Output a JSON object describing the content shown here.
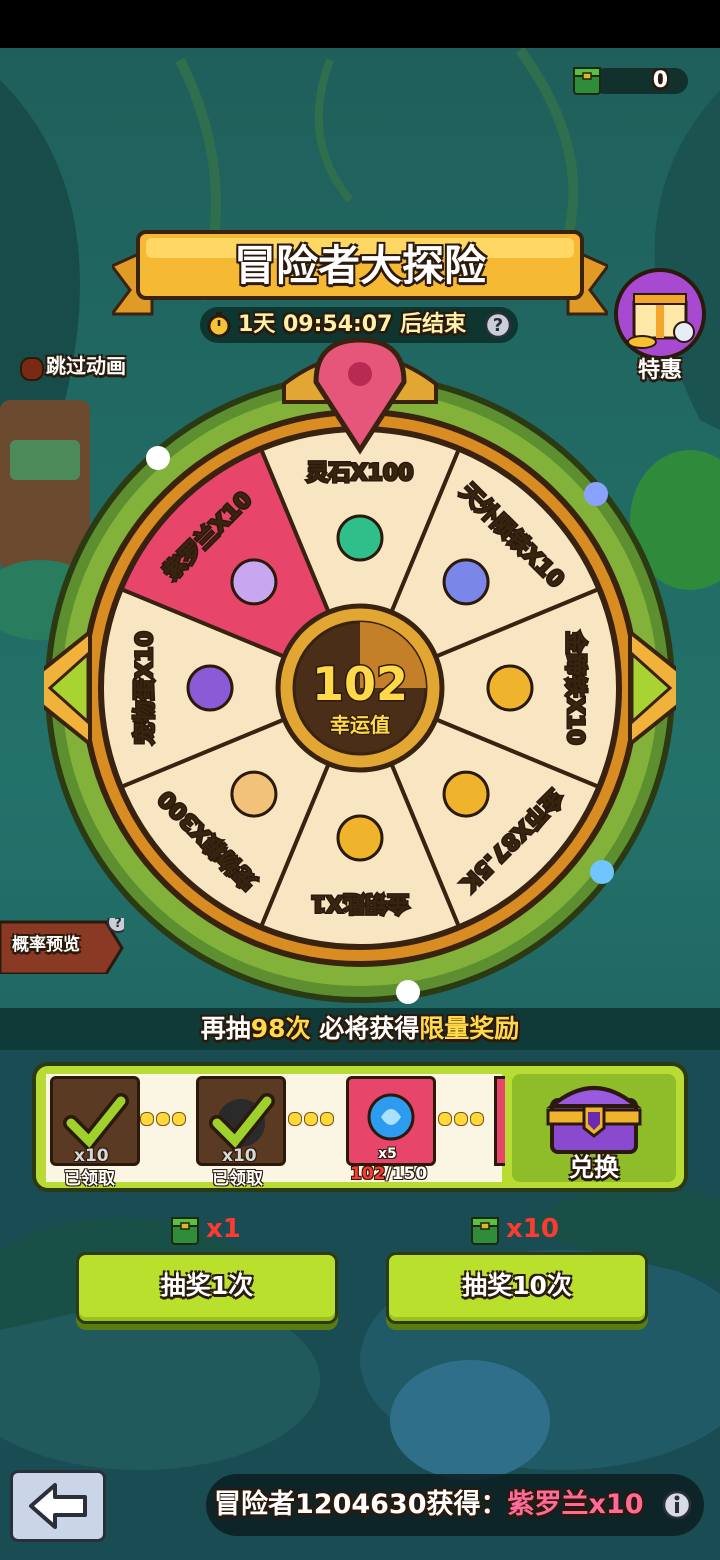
{
  "header": {
    "ticket_count": "0"
  },
  "event": {
    "title": "冒险者大探险",
    "timer": "1天 09:54:07 后结束"
  },
  "skip_animation": {
    "label": "跳过动画"
  },
  "special_offer": {
    "label": "特惠"
  },
  "wheel": {
    "segments": [
      {
        "label": "灵石X100",
        "icon": "spirit-stone-icon"
      },
      {
        "label": "天外陨铁X10",
        "icon": "meteorite-icon"
      },
      {
        "label": "金蹄铁X10",
        "icon": "horseshoe-icon"
      },
      {
        "label": "金币X87.5K",
        "icon": "gold-coin-icon"
      },
      {
        "label": "金钥匙X1",
        "icon": "golden-key-icon"
      },
      {
        "label": "宠物粮X300",
        "icon": "pet-food-bone-icon"
      },
      {
        "label": "宠物蛋X10",
        "icon": "pet-egg-icon"
      },
      {
        "label": "紫罗兰X10",
        "icon": "violet-flower-icon",
        "highlighted": true
      }
    ],
    "luck_value": "102",
    "luck_label": "幸运值"
  },
  "probability_preview": {
    "label": "概率预览"
  },
  "guarantee": {
    "prefix": "再抽",
    "count": "98次",
    "middle": " 必将获得",
    "reward": "限量奖励"
  },
  "milestones": [
    {
      "qty": "x10",
      "status": "已领取"
    },
    {
      "qty": "x10",
      "status": "已领取"
    },
    {
      "qty": "x5",
      "progress_current": "102",
      "progress_total": "/150"
    }
  ],
  "exchange": {
    "label": "兑换"
  },
  "draw_once": {
    "cost": "x1",
    "label": "抽奖1次"
  },
  "draw_ten": {
    "cost": "x10",
    "label": "抽奖10次"
  },
  "ticker": {
    "player": "冒险者1204630获得：",
    "item": "紫罗兰x10"
  },
  "colors": {
    "accent_green": "#b9e02c",
    "highlight_yellow": "#ffd94a",
    "cost_red": "#ff3b2f",
    "ticker_item_pink": "#ff6a9a"
  }
}
